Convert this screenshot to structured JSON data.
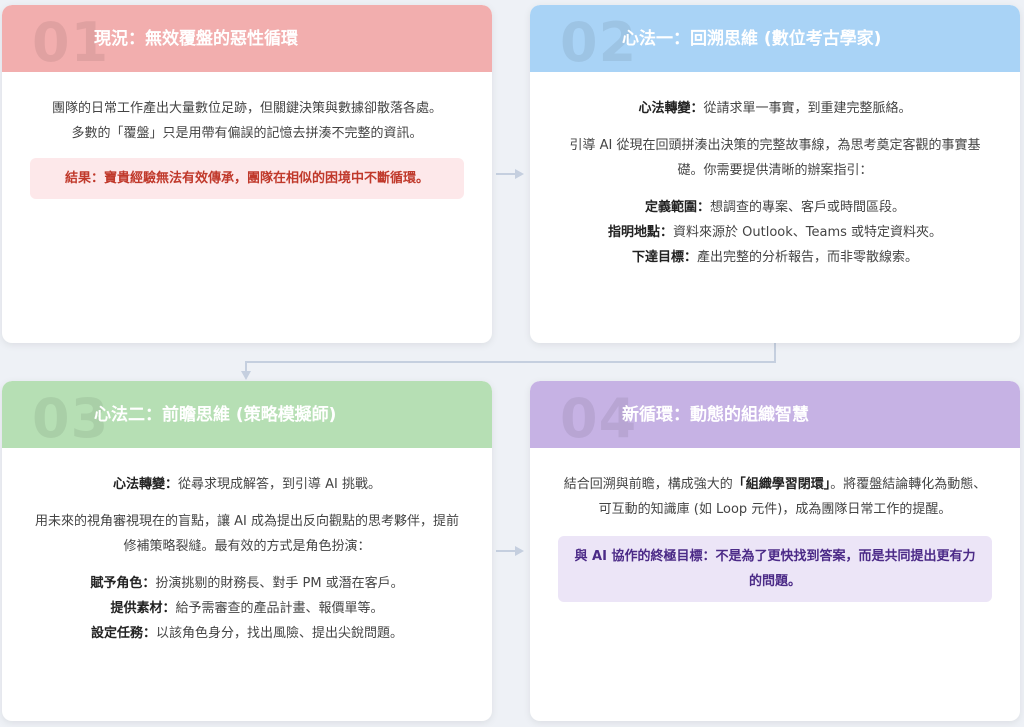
{
  "cards": [
    {
      "num": "01",
      "title": "現況：無效覆盤的惡性循環",
      "para1_line1": "團隊的日常工作產出大量數位足跡，但關鍵決策與數據卻散落各處。",
      "para1_line2": "多數的「覆盤」只是用帶有偏誤的記憶去拼湊不完整的資訊。",
      "result": "結果：寶貴經驗無法有效傳承，團隊在相似的困境中不斷循環。"
    },
    {
      "num": "02",
      "title": "心法一：回溯思維 (數位考古學家)",
      "shift_label": "心法轉變：",
      "shift_text": "從請求單一事實，到重建完整脈絡。",
      "para2": "引導 AI 從現在回頭拼湊出決策的完整故事線，為思考奠定客觀的事實基礎。你需要提供清晰的辦案指引：",
      "items": [
        {
          "label": "定義範圍：",
          "text": "想調查的專案、客戶或時間區段。"
        },
        {
          "label": "指明地點：",
          "text": "資料來源於 Outlook、Teams 或特定資料夾。"
        },
        {
          "label": "下達目標：",
          "text": "產出完整的分析報告，而非零散線索。"
        }
      ]
    },
    {
      "num": "03",
      "title": "心法二：前瞻思維 (策略模擬師)",
      "shift_label": "心法轉變：",
      "shift_text": "從尋求現成解答，到引導 AI 挑戰。",
      "para2": "用未來的視角審視現在的盲點，讓 AI 成為提出反向觀點的思考夥伴，提前修補策略裂縫。最有效的方式是角色扮演：",
      "items": [
        {
          "label": "賦予角色：",
          "text": "扮演挑剔的財務長、對手 PM 或潛在客戶。"
        },
        {
          "label": "提供素材：",
          "text": "給予需審查的產品計畫、報價單等。"
        },
        {
          "label": "設定任務：",
          "text": "以該角色身分，找出風險、提出尖銳問題。"
        }
      ]
    },
    {
      "num": "04",
      "title": "新循環：動態的組織智慧",
      "para_pre": "結合回溯與前瞻，構成強大的",
      "para_bold": "「組織學習閉環」",
      "para_post": "。將覆盤結論轉化為動態、可互動的知識庫 (如 Loop 元件)，成為團隊日常工作的提醒。",
      "goal": "與 AI 協作的終極目標：不是為了更快找到答案，而是共同提出更有力的問題。"
    }
  ]
}
